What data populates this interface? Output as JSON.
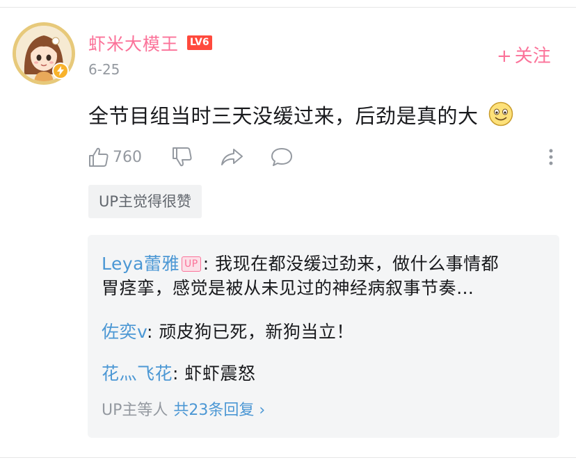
{
  "comment": {
    "username": "虾米大模王",
    "level": "LV6",
    "date": "6-25",
    "follow_label": "关注",
    "text": "全节目组当时三天没缓过来，后劲是真的大",
    "like_count": "760",
    "up_liked": "UP主觉得很赞"
  },
  "replies": [
    {
      "user": "Leya蕾雅",
      "badge": "UP",
      "sep": ":",
      "text": " 我现在都没缓过劲来，做什么事情都",
      "text2": "胃痉挛，感觉是被从未见过的神经病叙事节奏…"
    },
    {
      "user": "佐奕v",
      "sep": ":",
      "text": " 顽皮狗已死，新狗当立！"
    },
    {
      "user": "花灬飞花",
      "sep": ":",
      "text": " 虾虾震怒"
    }
  ],
  "reply_summary": {
    "prefix": "UP主等人",
    "total": "共23条回复",
    "arrow": "›"
  },
  "colors": {
    "pink": "#fb7299",
    "blue": "#4b97d4",
    "grey": "#9499a0",
    "panel": "#f4f5f6"
  }
}
